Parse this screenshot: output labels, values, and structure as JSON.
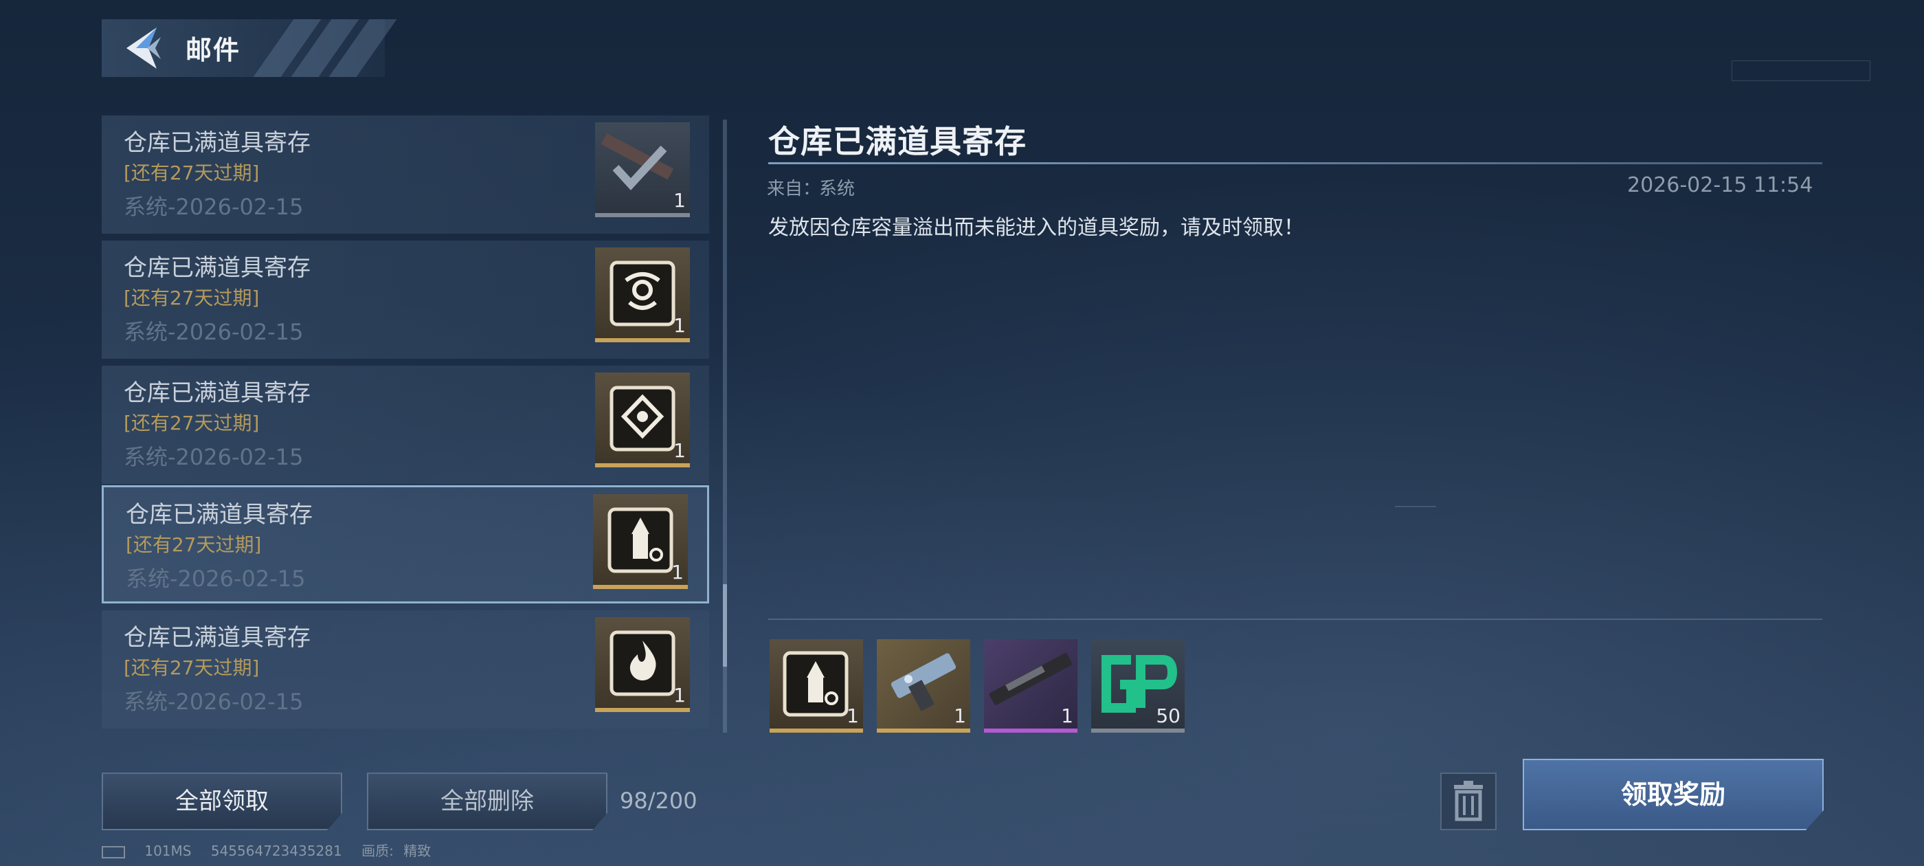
{
  "header": {
    "title": "邮件",
    "back_icon": "back-arrow-icon"
  },
  "mail_list": {
    "items": [
      {
        "title": "仓库已满道具寄存",
        "expire": "[还有27天过期]",
        "sender_date": "系统-2026-02-15",
        "icon": "weapon-claimed-icon",
        "count": "1",
        "selected": false
      },
      {
        "title": "仓库已满道具寄存",
        "expire": "[还有27天过期]",
        "sender_date": "系统-2026-02-15",
        "icon": "emblem-crest-icon",
        "count": "1",
        "selected": false
      },
      {
        "title": "仓库已满道具寄存",
        "expire": "[还有27天过期]",
        "sender_date": "系统-2026-02-15",
        "icon": "emblem-diamond-icon",
        "count": "1",
        "selected": false
      },
      {
        "title": "仓库已满道具寄存",
        "expire": "[还有27天过期]",
        "sender_date": "系统-2026-02-15",
        "icon": "ammo-upgrade-icon",
        "count": "1",
        "selected": true
      },
      {
        "title": "仓库已满道具寄存",
        "expire": "[还有27天过期]",
        "sender_date": "系统-2026-02-15",
        "icon": "fire-icon",
        "count": "1",
        "selected": false
      }
    ]
  },
  "detail": {
    "title": "仓库已满道具寄存",
    "from_label": "来自：",
    "from_value": "系统",
    "time": "2026-02-15 11:54",
    "body": "发放因仓库容量溢出而未能进入的道具奖励，请及时领取！",
    "attachments": [
      {
        "icon": "ammo-upgrade-icon",
        "count": "1",
        "rarity_color": "#c9a35a"
      },
      {
        "icon": "pistol-icon",
        "count": "1",
        "rarity_color": "#c9a35a"
      },
      {
        "icon": "rifle-icon",
        "count": "1",
        "rarity_color": "#b45ad2"
      },
      {
        "icon": "gp-currency-icon",
        "count": "50",
        "rarity_color": "#7f8894"
      }
    ]
  },
  "bottom": {
    "claim_all": "全部领取",
    "delete_all": "全部删除",
    "mail_count": "98/200",
    "claim_reward": "领取奖励",
    "trash_icon": "trash-icon"
  },
  "status": {
    "ping": "101MS",
    "uid": "545564723435281",
    "quality_label": "画质:",
    "quality_value": "精致"
  },
  "colors": {
    "accent_gold": "#c9a35a",
    "accent_blue": "#4f73a6",
    "expire_text": "#b59a5c"
  }
}
